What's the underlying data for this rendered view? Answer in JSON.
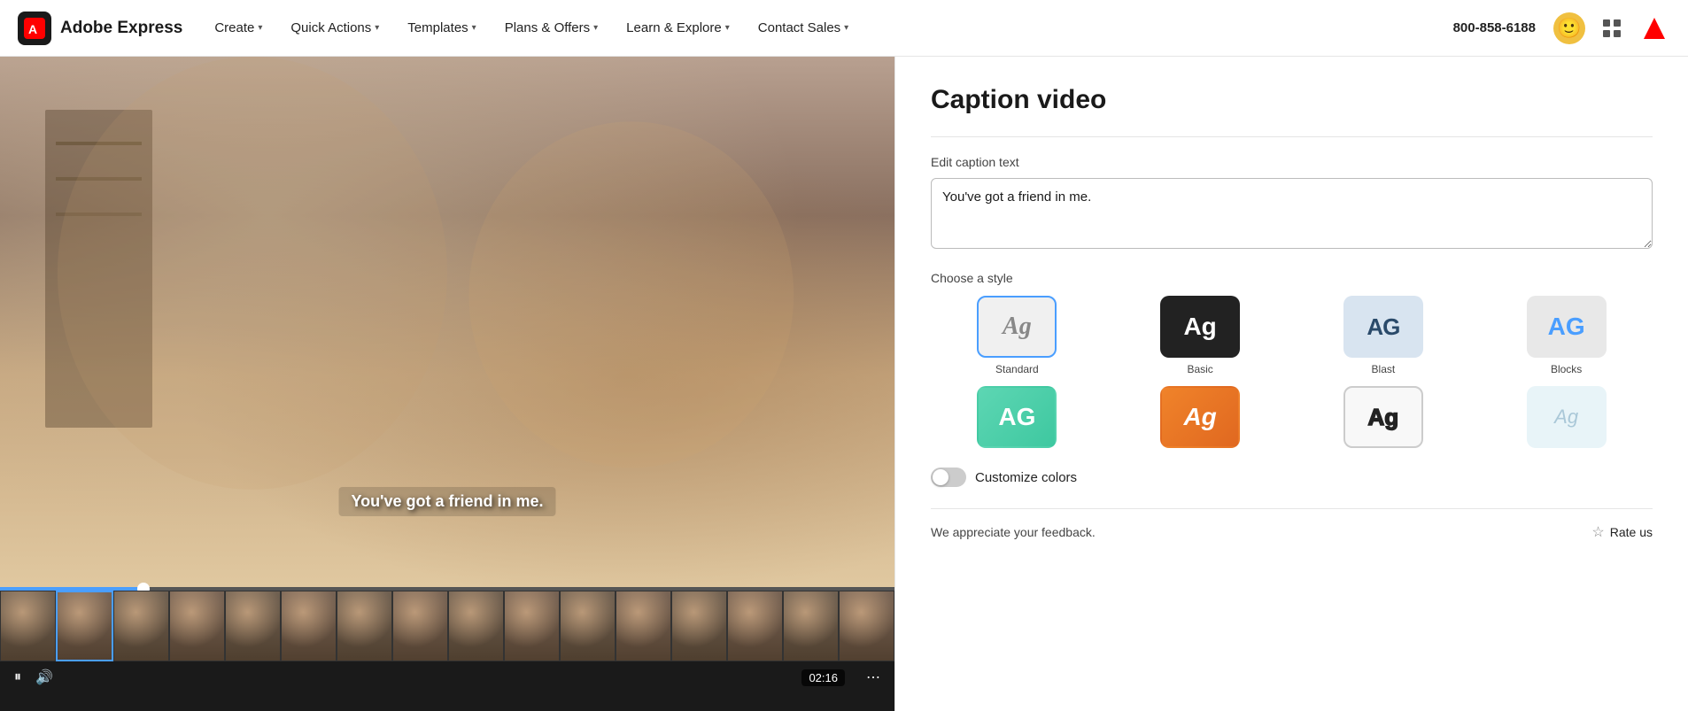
{
  "app": {
    "name": "Adobe Express",
    "logo_emoji": "🅰"
  },
  "navbar": {
    "create_label": "Create",
    "quick_actions_label": "Quick Actions",
    "templates_label": "Templates",
    "plans_label": "Plans & Offers",
    "learn_label": "Learn & Explore",
    "contact_label": "Contact Sales",
    "phone": "800-858-6188"
  },
  "panel": {
    "title": "Caption video",
    "edit_caption_label": "Edit caption text",
    "caption_text": "You've got a friend in me.",
    "choose_style_label": "Choose a style",
    "styles": [
      {
        "id": "standard",
        "label": "Standard",
        "selected": true
      },
      {
        "id": "basic",
        "label": "Basic",
        "selected": false
      },
      {
        "id": "blast",
        "label": "Blast",
        "selected": false
      },
      {
        "id": "blocks",
        "label": "Blocks",
        "selected": false
      },
      {
        "id": "color1",
        "label": "",
        "selected": false
      },
      {
        "id": "color2",
        "label": "",
        "selected": false
      },
      {
        "id": "outline",
        "label": "",
        "selected": false
      },
      {
        "id": "light",
        "label": "",
        "selected": false
      }
    ],
    "customize_label": "Customize colors",
    "feedback_text": "We appreciate your feedback.",
    "rate_us_label": "Rate us"
  },
  "video": {
    "caption_overlay": "You've got a friend in me.",
    "time": "02:16"
  }
}
